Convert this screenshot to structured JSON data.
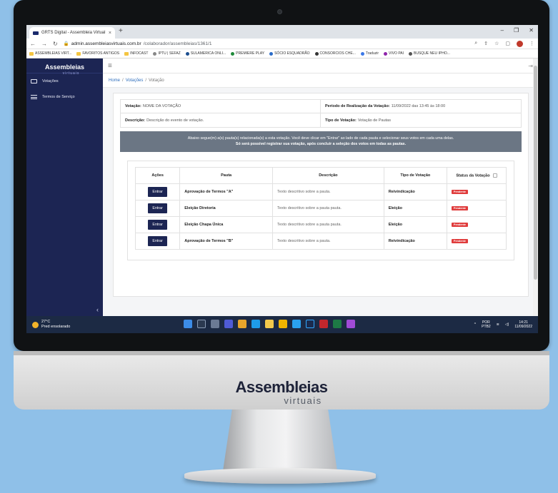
{
  "browser": {
    "tab_title": "GRTS Digital - Assembleia Virtual",
    "tab_close": "×",
    "new_tab": "+",
    "url_host": "admin.assembleiasvirtuais.com.br",
    "url_path": "/colaborador/assembleias/1361/1",
    "bookmarks": [
      "ASSEMBLEIAS VIRT...",
      "FAVORITOS ANTIGOS",
      "INFOCAST",
      "IPTU | SEFAZ",
      "SULAMERICA ONLI...",
      "PREMIERE PLAY",
      "SÓCIO ESQUADRÃO",
      "CONSORCIOS CHE...",
      "Traduzir",
      "VIVO PAI",
      "BUSQUE NEU IPHO..."
    ]
  },
  "brand": {
    "name": "Assembleias",
    "sub": "virtuais"
  },
  "sidebar": {
    "items": [
      {
        "label": "Votações"
      },
      {
        "label": "Termos de Serviço"
      }
    ],
    "collapse": "‹"
  },
  "breadcrumb": {
    "home": "Home",
    "sep": "/",
    "votacoes": "Votações",
    "current": "Votação"
  },
  "info": {
    "votacao_label": "Votação:",
    "votacao_value": "NOME DA VOTAÇÃO",
    "periodo_label": "Período de Realização da Votação:",
    "periodo_value": "11/09/2022 das 13:45 às 18:00",
    "descricao_label": "Descrição:",
    "descricao_value": "Descrição do evento de votação.",
    "tipo_label": "Tipo de Votação:",
    "tipo_value": "Votação de Pautas"
  },
  "notice": {
    "line1": "Abaixo segue(m) a(s) pauta(s) relacionada(s) a esta votação. Você deve clicar em \"Entrar\" ao lado de cada pauta e selecionar seus votos em cada uma delas.",
    "line2": "Só será possível registrar sua votação, após concluir a seleção dos votos em todas as pautas."
  },
  "table": {
    "headers": [
      "Ações",
      "Pauta",
      "Descrição",
      "Tipo de Votação",
      "Status da Votação"
    ],
    "button_label": "Entrar",
    "rows": [
      {
        "pauta": "Aprovação de Termos \"A\"",
        "descricao": "Texto descritivo sobre a pauta.",
        "tipo": "Reivindicação",
        "status": "Pendente"
      },
      {
        "pauta": "Eleição Diretoria",
        "descricao": "Texto descritivo sobre a pauta pauta.",
        "tipo": "Eleição",
        "status": "Pendente"
      },
      {
        "pauta": "Eleição Chapa Única",
        "descricao": "Texto descritivo sobre a pauta pauta.",
        "tipo": "Eleição",
        "status": "Pendente"
      },
      {
        "pauta": "Aprovação de Termos \"B\"",
        "descricao": "Texto descritivo sobre a pauta.",
        "tipo": "Reivindicação",
        "status": "Pendente"
      }
    ]
  },
  "taskbar": {
    "temp": "27°C",
    "weather": "Pred ensolarado",
    "lang1": "POR",
    "lang2": "PTB2",
    "time": "14:21",
    "date": "11/09/2022"
  },
  "colors": {
    "sidebar": "#1c2553",
    "accent": "#2f6fbd",
    "badge": "#e03c3c"
  }
}
